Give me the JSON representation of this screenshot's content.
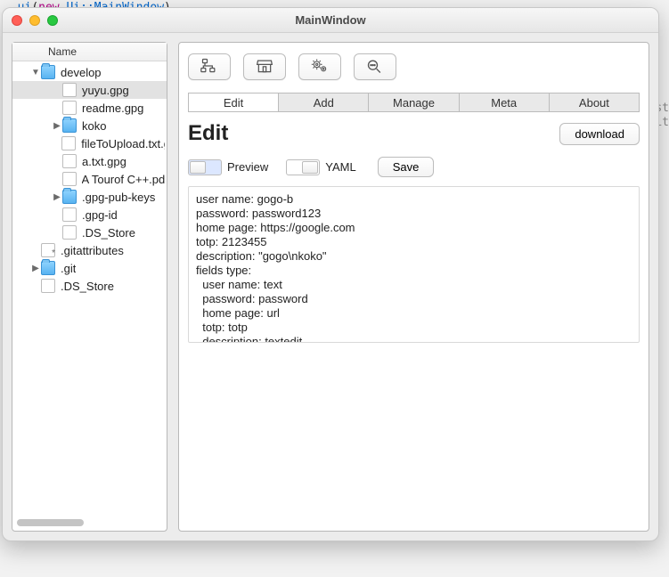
{
  "background_code": {
    "t1": ", ",
    "t2": "ui",
    "t3": "(",
    "t4": "new ",
    "t5": "Ui::MainWindow",
    "t6": ")"
  },
  "right_ghost": [
    "st",
    "it"
  ],
  "window": {
    "title": "MainWindow"
  },
  "sidebar": {
    "header": "Name",
    "items": [
      {
        "label": "develop",
        "type": "folder",
        "expand": "down",
        "indent": 1,
        "sel": false
      },
      {
        "label": "yuyu.gpg",
        "type": "file",
        "indent": 2,
        "sel": true
      },
      {
        "label": "readme.gpg",
        "type": "file",
        "indent": 2
      },
      {
        "label": "koko",
        "type": "folder",
        "expand": "right",
        "indent": 2
      },
      {
        "label": "fileToUpload.txt.g",
        "type": "file",
        "indent": 2
      },
      {
        "label": "a.txt.gpg",
        "type": "file",
        "indent": 2
      },
      {
        "label": "A Tourof C++.pdf",
        "type": "file",
        "indent": 2
      },
      {
        "label": ".gpg-pub-keys",
        "type": "folder",
        "expand": "right",
        "indent": 2
      },
      {
        "label": ".gpg-id",
        "type": "file",
        "indent": 2
      },
      {
        "label": ".DS_Store",
        "type": "file",
        "indent": 2
      },
      {
        "label": ".gitattributes",
        "type": "file-gear",
        "indent": 1
      },
      {
        "label": ".git",
        "type": "folder",
        "expand": "right",
        "indent": 1
      },
      {
        "label": ".DS_Store",
        "type": "file",
        "indent": 1
      }
    ]
  },
  "tabs": [
    {
      "label": "Edit",
      "active": true
    },
    {
      "label": "Add"
    },
    {
      "label": "Manage"
    },
    {
      "label": "Meta"
    },
    {
      "label": "About"
    }
  ],
  "page": {
    "title": "Edit",
    "download": "download",
    "preview_label": "Preview",
    "yaml_label": "YAML",
    "save_label": "Save"
  },
  "editor_text": "user name: gogo-b\npassword: password123\nhome page: https://google.com\ntotp: 2123455\ndescription: \"gogo\\nkoko\"\nfields type:\n  user name: text\n  password: password\n  home page: url\n  totp: totp\n  description: textedit"
}
